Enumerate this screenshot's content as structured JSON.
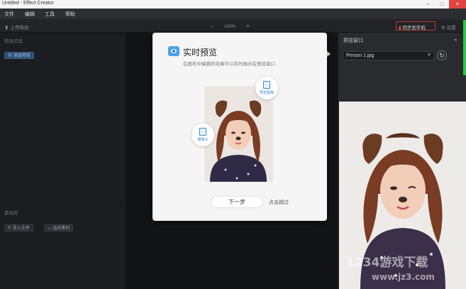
{
  "window": {
    "title": "Untitled - Effect Creator"
  },
  "menu": [
    "文件",
    "编辑",
    "工具",
    "帮助"
  ],
  "toolbar": {
    "upload_label": "上传特效",
    "zoom": "100%",
    "zoom_minus": "−",
    "zoom_plus": "+",
    "sync_phone": "同步到手机",
    "settings": "设置"
  },
  "left_panel": {
    "section1_title": "特效信息",
    "add_button": "添加特效",
    "section2_title": "素材库",
    "import_file": "导入文件",
    "import_material": "选择素材"
  },
  "right_panel": {
    "title": "预览窗口",
    "selected_file": "Person 1.jpg"
  },
  "modal": {
    "title": "实时预览",
    "subtitle": "在画布中编辑的效果可以实时展示在预览窗口",
    "bubble_top": "预览图像",
    "bubble_left": "摄像头",
    "next_button": "下一步",
    "skip_link": "点击跳过"
  },
  "watermark": {
    "main": "1234游戏下载",
    "sub": "www.jz3.com"
  },
  "colors": {
    "accent": "#4aa3e6",
    "dark_bg": "#1e1f22",
    "panel": "#2a2b2f",
    "modal_bg": "#f5f5f5",
    "ear": "#6b3b22",
    "hair": "#7a3c22"
  }
}
